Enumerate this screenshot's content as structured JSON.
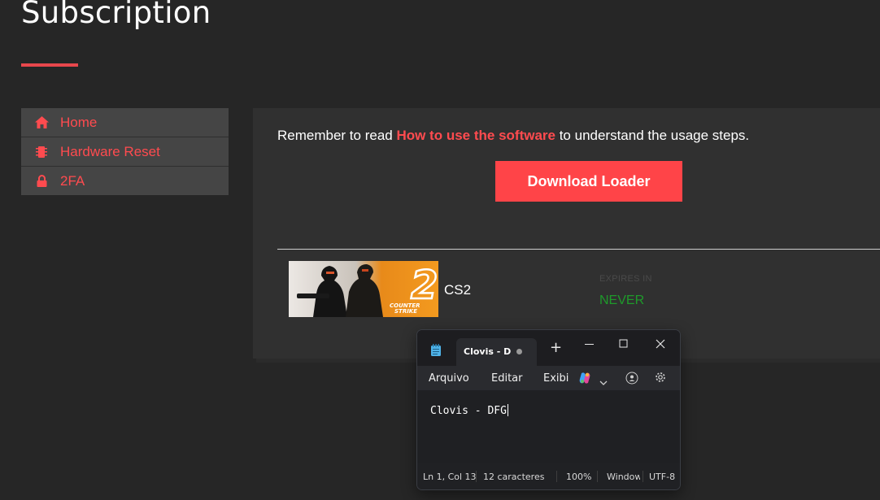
{
  "page": {
    "title": "Subscription"
  },
  "sidebar": {
    "items": [
      {
        "label": "Home",
        "icon": "home-icon"
      },
      {
        "label": "Hardware Reset",
        "icon": "chip-icon"
      },
      {
        "label": "2FA",
        "icon": "lock-icon"
      }
    ]
  },
  "main": {
    "reminder_prefix": "Remember to read ",
    "reminder_link": "How to use the software",
    "reminder_suffix": " to understand the usage steps.",
    "download_label": "Download Loader",
    "game": {
      "name": "CS2",
      "thumb_line1": "COUNTER",
      "thumb_line2": "STRIKE",
      "expires_label": "EXPIRES IN",
      "expires_value": "NEVER"
    }
  },
  "notepad": {
    "tab_title": "Clovis - D",
    "menu": [
      "Arquivo",
      "Editar",
      "Exibi"
    ],
    "content": "Clovis - DFG",
    "status": {
      "position": "Ln 1, Col 13",
      "chars": "12 caracteres",
      "zoom": "100%",
      "line_ending": "Windows (CRLF)",
      "encoding": "UTF-8"
    }
  },
  "colors": {
    "accent": "#ff4b4f",
    "background": "#262626",
    "panel": "#303030",
    "never": "#1e9a2a"
  }
}
